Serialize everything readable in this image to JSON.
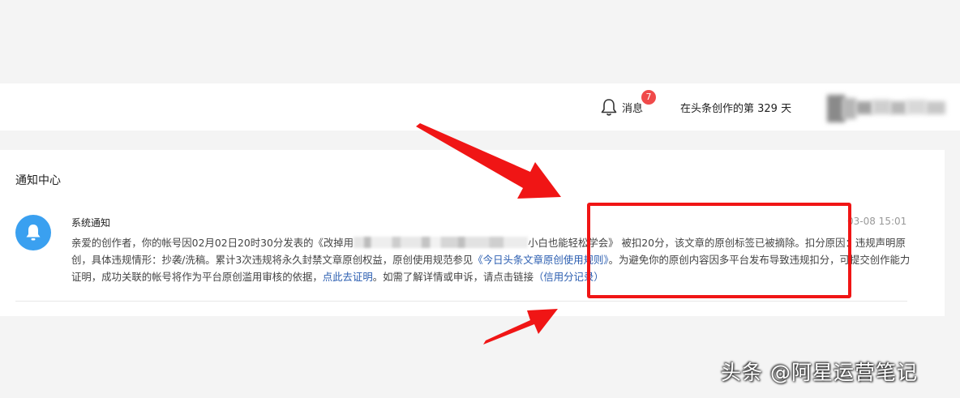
{
  "header": {
    "badge_count": "7",
    "messages_label": "消息",
    "days_text": "在头条创作的第 329 天"
  },
  "notification_center": {
    "title": "通知中心",
    "item": {
      "title": "系统通知",
      "time": "03-08 15:01",
      "body_part1": "亲爱的创作者，你的帐号因02月02日20时30分发表的《改掉用",
      "body_part2": "小白也能轻松学会》 被扣20分，该文章的原创标签已被摘除。扣分原因：违规声明原创，具体违规情形：抄袭/洗稿。累计3次违规将永久封禁文章原创权益，原创使用规范参见",
      "rules_link": "《今日头条文章原创使用规则》",
      "body_part3": "。为避免你的原创内容因多平台发布导致违规扣分，可提交创作能力证明，成功关联的帐号将作为平台原创滥用审核的依据，",
      "prove_link": "点此去证明",
      "body_part4": "。如需了解详情或申诉，请点击链接",
      "credit_link": "（信用分记录）"
    }
  },
  "watermark": "头条 @阿星运营笔记",
  "colors": {
    "accent_link": "#2a5db0",
    "badge": "#f04a4a",
    "avatar": "#3aa0f0",
    "annotation_red": "#f01515"
  }
}
